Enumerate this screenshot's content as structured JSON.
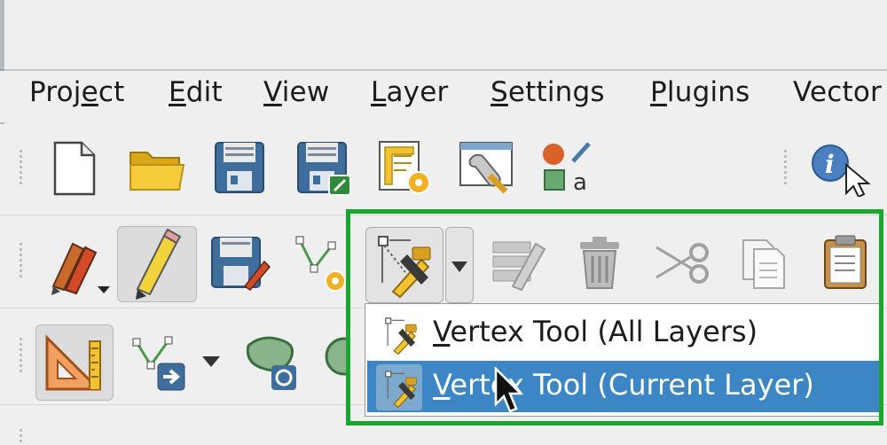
{
  "menubar": {
    "items": [
      {
        "id": "project",
        "label": "Project",
        "mnemonic_index": 4
      },
      {
        "id": "edit",
        "label": "Edit",
        "mnemonic_index": 0
      },
      {
        "id": "view",
        "label": "View",
        "mnemonic_index": 0
      },
      {
        "id": "layer",
        "label": "Layer",
        "mnemonic_index": 0
      },
      {
        "id": "settings",
        "label": "Settings",
        "mnemonic_index": 0
      },
      {
        "id": "plugins",
        "label": "Plugins",
        "mnemonic_index": 0
      },
      {
        "id": "vector",
        "label": "Vector",
        "mnemonic_index": -1
      }
    ]
  },
  "toolbars": {
    "project": [
      "new-project-icon",
      "open-project-icon",
      "save-project-icon",
      "save-project-as-icon",
      "layout-manager-icon",
      "style-manager-icon",
      "text-annotation-icon"
    ],
    "attributes": [
      "identify-features-icon"
    ],
    "digitizing": [
      "current-edits-icon",
      "toggle-editing-icon",
      "save-layer-edits-icon",
      "add-feature-icon",
      "vertex-tool-icon",
      "modify-attributes-icon",
      "delete-selected-icon",
      "cut-features-icon",
      "copy-features-icon",
      "paste-features-icon"
    ],
    "snapping": [
      "enable-snapping-icon",
      "digitize-with-segment-icon",
      "reshape-features-icon"
    ]
  },
  "vertex_menu": {
    "items": [
      {
        "id": "all-layers",
        "label": "Vertex Tool (All Layers)",
        "selected": false
      },
      {
        "id": "current-layer",
        "label": "Vertex Tool (Current Layer)",
        "selected": true
      }
    ]
  },
  "colors": {
    "highlight_box": "#1aa52e",
    "menu_selection": "#3d86c6",
    "toolbar_bg": "#efefef"
  }
}
